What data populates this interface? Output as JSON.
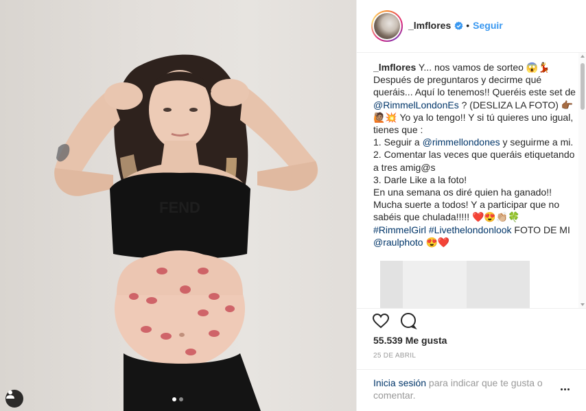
{
  "post": {
    "username": "_lmflores",
    "follow_label": "Seguir",
    "bullet": "•",
    "caption": {
      "author": "_lmflores",
      "segments": [
        {
          "t": " Y... nos vamos de sorteo 😱💃 Después de preguntaros y decirme qué queráis... Aquí lo tenemos!! Queréis este set de "
        },
        {
          "t": "@RimmelLondonEs",
          "link": true
        },
        {
          "t": " ? (DESLIZA LA FOTO) 👉🏾🙋🏽💥 Yo ya lo tengo!! Y si tú quieres uno igual, tienes que :"
        },
        {
          "br": true
        },
        {
          "t": "1. Seguir a "
        },
        {
          "t": "@rimmellondones",
          "link": true
        },
        {
          "t": " y seguirme a mi."
        },
        {
          "br": true
        },
        {
          "t": "2. Comentar las veces que queráis etiquetando a tres amig@s"
        },
        {
          "br": true
        },
        {
          "t": "3. Darle Like a la foto!"
        },
        {
          "br": true
        },
        {
          "t": "En una semana os diré quien ha ganado!! Mucha suerte a todos! Y a participar que no sabéis que chulada!!!!! ❤️😍👏🏼🍀"
        },
        {
          "br": true
        },
        {
          "t": "#RimmelGirl",
          "link": true
        },
        {
          "t": " "
        },
        {
          "t": "#Livethelondonlook",
          "link": true
        },
        {
          "t": " FOTO DE MI "
        },
        {
          "t": "@raulphoto",
          "link": true
        },
        {
          "t": " 😍❤️"
        }
      ]
    },
    "likes_label": "55.539 Me gusta",
    "date_label": "25 DE ABRIL",
    "login": {
      "link": "Inicia sesión",
      "rest": " para indicar que te gusta o comentar."
    }
  },
  "colors": {
    "accent": "#3897f0",
    "link": "#003569",
    "text": "#262626",
    "muted": "#999999"
  },
  "icons": [
    "user-tag-icon",
    "verified-badge-icon",
    "heart-icon",
    "comment-icon",
    "more-options-icon"
  ],
  "carousel": {
    "count": 2,
    "active": 1
  }
}
